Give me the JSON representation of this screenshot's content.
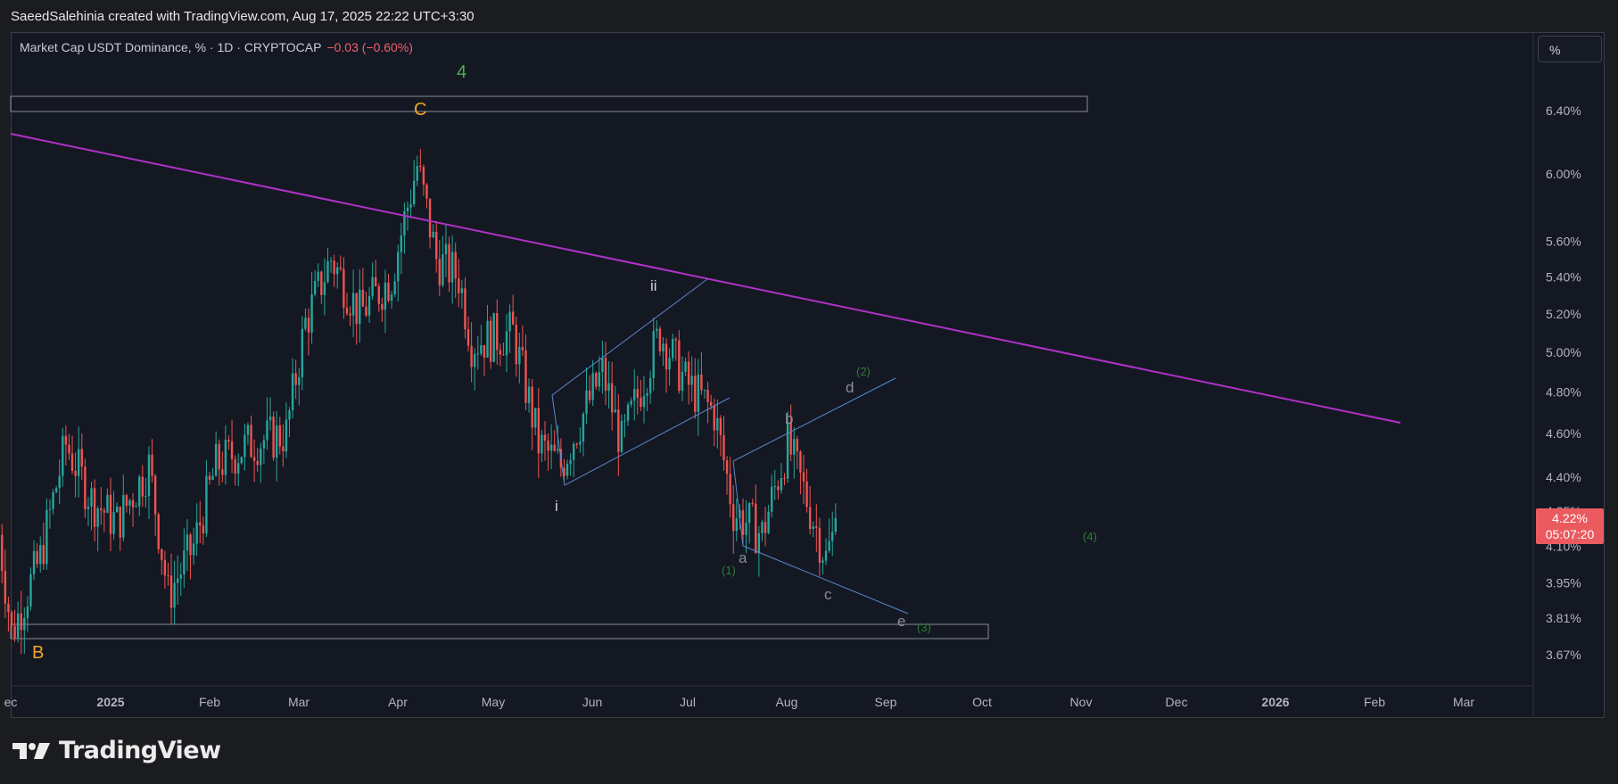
{
  "header": {
    "attribution": "SaeedSalehinia created with TradingView.com, Aug 17, 2025 22:22 UTC+3:30"
  },
  "symbol": {
    "name": "Market Cap USDT Dominance, % · 1D · CRYPTOCAP",
    "change": "−0.03 (−0.60%)"
  },
  "scale_button": {
    "label": "%"
  },
  "price_tag": {
    "price": "4.22%",
    "countdown": "05:07:20"
  },
  "brand": {
    "name": "TradingView"
  },
  "colors": {
    "up": "#26a69a",
    "down": "#ef5350",
    "trendline": "#b031c6",
    "channel": "#5b86c9",
    "wave_orange": "#f5a623",
    "wave_green": "#2e7d32",
    "wave_green_bright": "#4caf50",
    "price_tag": "#ea5a5f"
  },
  "price_axis": {
    "labels": [
      "6.40%",
      "6.00%",
      "5.60%",
      "5.40%",
      "5.20%",
      "5.00%",
      "4.80%",
      "4.60%",
      "4.40%",
      "4.25%",
      "4.10%",
      "3.95%",
      "3.81%",
      "3.67%"
    ]
  },
  "time_axis": {
    "labels": [
      {
        "text": "ec",
        "bold": false
      },
      {
        "text": "2025",
        "bold": true
      },
      {
        "text": "Feb",
        "bold": false
      },
      {
        "text": "Mar",
        "bold": false
      },
      {
        "text": "Apr",
        "bold": false
      },
      {
        "text": "May",
        "bold": false
      },
      {
        "text": "Jun",
        "bold": false
      },
      {
        "text": "Jul",
        "bold": false
      },
      {
        "text": "Aug",
        "bold": false
      },
      {
        "text": "Sep",
        "bold": false
      },
      {
        "text": "Oct",
        "bold": false
      },
      {
        "text": "Nov",
        "bold": false
      },
      {
        "text": "Dec",
        "bold": false
      },
      {
        "text": "2026",
        "bold": true
      },
      {
        "text": "Feb",
        "bold": false
      },
      {
        "text": "Mar",
        "bold": false
      }
    ]
  },
  "wave_labels": {
    "four": "4",
    "c_major": "C",
    "b_major": "B",
    "i": "i",
    "ii": "ii",
    "a": "a",
    "b": "b",
    "c": "c",
    "d": "d",
    "e": "e",
    "w1": "(1)",
    "w2": "(2)",
    "w3": "(3)",
    "w4": "(4)"
  },
  "chart_data": {
    "type": "candlestick",
    "title": "Market Cap USDT Dominance, % · 1D · CRYPTOCAP",
    "last_price": 4.22,
    "change": -0.03,
    "change_pct": -0.6,
    "ylim": [
      3.6,
      6.6
    ],
    "y_scale": "log",
    "x_range": [
      "2024-11-27",
      "2026-03-20"
    ],
    "anchors": [
      {
        "date": "2024-11-27",
        "price": 4.15
      },
      {
        "date": "2024-12-01",
        "price": 3.75
      },
      {
        "date": "2024-12-10",
        "price": 4.05
      },
      {
        "date": "2024-12-18",
        "price": 4.55
      },
      {
        "date": "2024-12-26",
        "price": 4.3
      },
      {
        "date": "2025-01-03",
        "price": 4.2
      },
      {
        "date": "2025-01-13",
        "price": 4.45
      },
      {
        "date": "2025-01-19",
        "price": 3.9
      },
      {
        "date": "2025-01-27",
        "price": 4.1
      },
      {
        "date": "2025-02-03",
        "price": 4.45
      },
      {
        "date": "2025-02-13",
        "price": 4.55
      },
      {
        "date": "2025-02-25",
        "price": 4.6
      },
      {
        "date": "2025-03-03",
        "price": 5.15
      },
      {
        "date": "2025-03-11",
        "price": 5.5
      },
      {
        "date": "2025-03-20",
        "price": 5.2
      },
      {
        "date": "2025-03-30",
        "price": 5.4
      },
      {
        "date": "2025-04-07",
        "price": 6.05
      },
      {
        "date": "2025-04-13",
        "price": 5.5
      },
      {
        "date": "2025-04-20",
        "price": 5.4
      },
      {
        "date": "2025-04-24",
        "price": 5.05
      },
      {
        "date": "2025-05-07",
        "price": 5.1
      },
      {
        "date": "2025-05-15",
        "price": 4.55
      },
      {
        "date": "2025-05-22",
        "price": 4.45
      },
      {
        "date": "2025-06-04",
        "price": 4.9
      },
      {
        "date": "2025-06-10",
        "price": 4.55
      },
      {
        "date": "2025-06-22",
        "price": 5.1
      },
      {
        "date": "2025-06-30",
        "price": 4.85
      },
      {
        "date": "2025-07-09",
        "price": 4.7
      },
      {
        "date": "2025-07-15",
        "price": 4.25
      },
      {
        "date": "2025-07-24",
        "price": 4.15
      },
      {
        "date": "2025-08-01",
        "price": 4.55
      },
      {
        "date": "2025-08-07",
        "price": 4.3
      },
      {
        "date": "2025-08-13",
        "price": 4.05
      },
      {
        "date": "2025-08-17",
        "price": 4.22
      }
    ],
    "annotations": {
      "trendline": [
        {
          "date": "2024-11-27",
          "price": 6.25
        },
        {
          "date": "2026-02-11",
          "price": 4.65
        }
      ],
      "resistance_box": [
        6.3,
        6.45
      ],
      "support_box": [
        3.77,
        3.82
      ],
      "channel_impulse": [
        [
          {
            "date": "2025-05-22",
            "price": 4.8
          },
          {
            "date": "2025-06-29",
            "price": 5.4
          }
        ],
        [
          {
            "date": "2025-05-24",
            "price": 4.37
          },
          {
            "date": "2025-07-12",
            "price": 4.8
          }
        ]
      ],
      "triangle": [
        [
          {
            "date": "2025-07-14",
            "price": 4.5
          },
          {
            "date": "2025-09-07",
            "price": 4.9
          }
        ],
        [
          {
            "date": "2025-07-17",
            "price": 4.12
          },
          {
            "date": "2025-09-06",
            "price": 3.84
          }
        ]
      ]
    }
  }
}
